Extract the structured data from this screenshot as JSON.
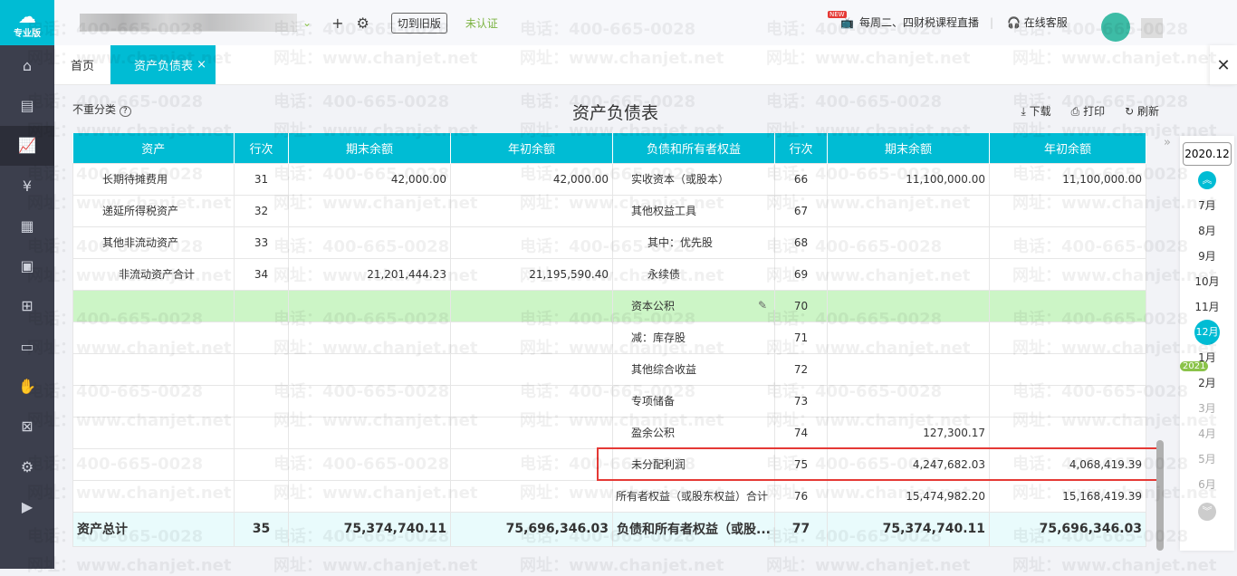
{
  "sidebar": {
    "logo_label": "专业版",
    "items": [
      "home",
      "invoice",
      "chart",
      "money",
      "report",
      "voucher",
      "stamp",
      "screen",
      "hand",
      "tax",
      "settings",
      "video"
    ]
  },
  "topbar": {
    "switch_old": "切到旧版",
    "unverified": "未认证",
    "new_badge": "NEW",
    "live": "每周二、四财税课程直播",
    "service": "在线客服"
  },
  "tabs": {
    "home": "首页",
    "active": "资产负债表",
    "close": "×"
  },
  "report": {
    "no_reclass": "不重分类",
    "title": "资产负债表",
    "download": "下载",
    "print": "打印",
    "refresh": "刷新"
  },
  "table": {
    "headers": [
      "资产",
      "行次",
      "期末余额",
      "年初余额",
      "负债和所有者权益",
      "行次",
      "期末余额",
      "年初余额"
    ],
    "rows": [
      [
        "长期待摊费用",
        "31",
        "42,000.00",
        "42,000.00",
        "实收资本（或股本）",
        "66",
        "11,100,000.00",
        "11,100,000.00"
      ],
      [
        "递延所得税资产",
        "32",
        "",
        "",
        "其他权益工具",
        "67",
        "",
        ""
      ],
      [
        "其他非流动资产",
        "33",
        "",
        "",
        "其中：优先股",
        "68",
        "",
        ""
      ],
      [
        "非流动资产合计",
        "34",
        "21,201,444.23",
        "21,195,590.40",
        "永续债",
        "69",
        "",
        ""
      ],
      [
        "",
        "",
        "",
        "",
        "资本公积",
        "70",
        "",
        ""
      ],
      [
        "",
        "",
        "",
        "",
        "减：库存股",
        "71",
        "",
        ""
      ],
      [
        "",
        "",
        "",
        "",
        "其他综合收益",
        "72",
        "",
        ""
      ],
      [
        "",
        "",
        "",
        "",
        "专项储备",
        "73",
        "",
        ""
      ],
      [
        "",
        "",
        "",
        "",
        "盈余公积",
        "74",
        "127,300.17",
        ""
      ],
      [
        "",
        "",
        "",
        "",
        "未分配利润",
        "75",
        "4,247,682.03",
        "4,068,419.39"
      ],
      [
        "",
        "",
        "",
        "",
        "所有者权益（或股东权益）合计",
        "76",
        "15,474,982.20",
        "15,168,419.39"
      ]
    ],
    "total": [
      "资产总计",
      "35",
      "75,374,740.11",
      "75,696,346.03",
      "负债和所有者权益（或股...",
      "77",
      "75,374,740.11",
      "75,696,346.03"
    ]
  },
  "calendar": {
    "period": "2020.12",
    "year_badge": "2021",
    "months": [
      "7月",
      "8月",
      "9月",
      "10月",
      "11月",
      "12月",
      "1月",
      "2月",
      "3月",
      "4月",
      "5月",
      "6月"
    ],
    "selected": "12月"
  },
  "watermark": {
    "phone": "电话：400-665-0028",
    "site": "网址：www.chanjet.net"
  }
}
